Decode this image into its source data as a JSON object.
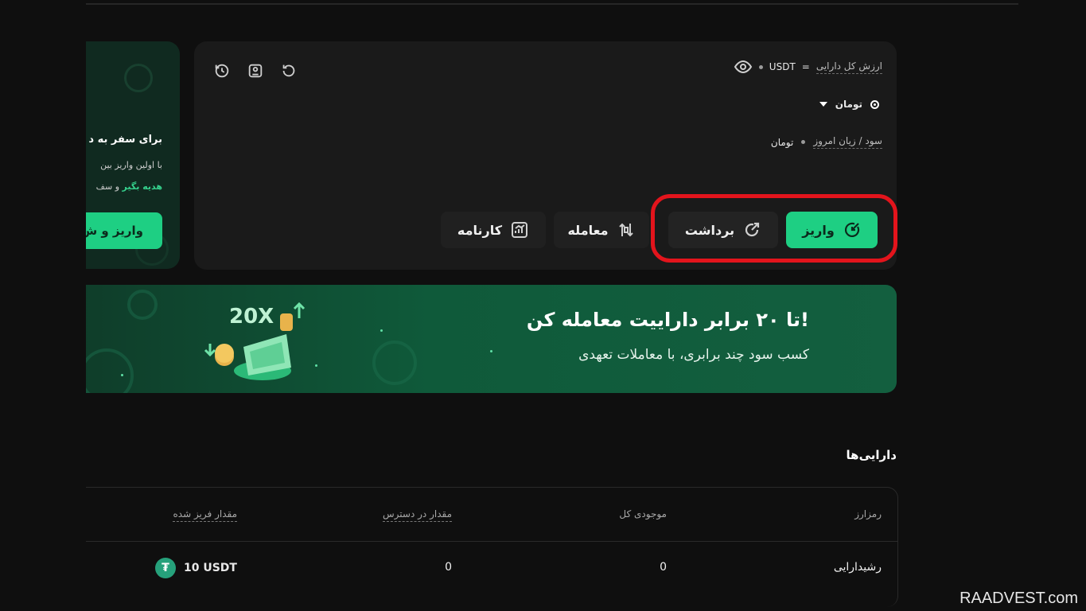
{
  "promo": {
    "title": "برای سفر به د",
    "line1": "با اولین واریز بین",
    "line2_green": "هدیه بگیر",
    "line2_rest": "و سف",
    "button": "واریز و ش"
  },
  "balance": {
    "label": "ارزش کل دارایی",
    "eq": "=",
    "currency_usdt": "USDT",
    "currency_toman": "تومان",
    "pnl_label": "سود / زیان امروز",
    "pnl_currency": "تومان"
  },
  "actions": {
    "deposit": "واریز",
    "withdraw": "برداشت",
    "trade": "معامله",
    "report": "کارنامه"
  },
  "banner": {
    "title": "تا ۲۰ برابر داراییت معامله کن!",
    "subtitle": "کسب سود چند برابری، با معاملات تعهدی",
    "badge": "20X"
  },
  "assets": {
    "title": "دارایی‌ها",
    "columns": {
      "crypto": "رمزارز",
      "total": "موجودی کل",
      "available": "مقدار در دسترس",
      "frozen": "مقدار فریز شده"
    },
    "rows": [
      {
        "crypto": "رشیدارایی",
        "total": "0",
        "available": "0",
        "frozen": "10 USDT"
      }
    ]
  },
  "watermark": "RAADVEST.com",
  "colors": {
    "accent": "#1ecf83",
    "highlight": "#e3141c",
    "card": "#1a1a1a",
    "bg": "#0f0f0f"
  }
}
